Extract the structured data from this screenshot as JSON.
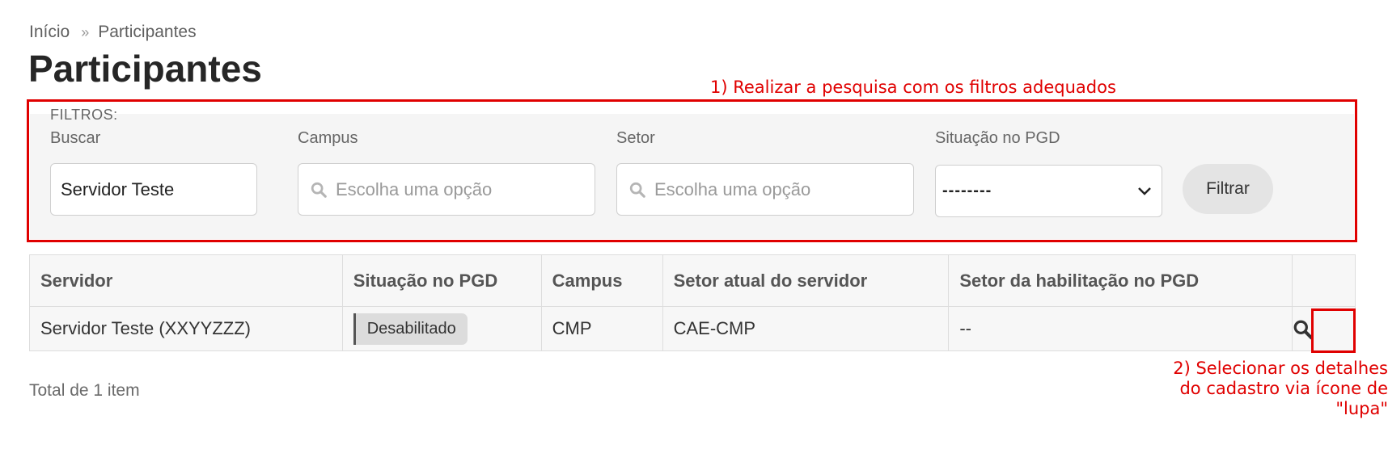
{
  "breadcrumb": {
    "home": "Início",
    "separator": "»",
    "current": "Participantes"
  },
  "page_title": "Participantes",
  "annotations": {
    "step1": "1) Realizar a pesquisa com os filtros adequados",
    "step2_line1": "2) Selecionar os detalhes",
    "step2_line2": "do cadastro via ícone de",
    "step2_line3": "\"lupa\"",
    "color": "#e00000"
  },
  "filters": {
    "legend": "FILTROS:",
    "buscar": {
      "label": "Buscar",
      "value": "Servidor Teste"
    },
    "campus": {
      "label": "Campus",
      "placeholder": "Escolha uma opção",
      "icon": "search-icon"
    },
    "setor": {
      "label": "Setor",
      "placeholder": "Escolha uma opção",
      "icon": "search-icon"
    },
    "situacao": {
      "label": "Situação no PGD",
      "selected": "--------",
      "icon": "chevron-down-icon"
    },
    "submit_label": "Filtrar"
  },
  "table": {
    "headers": [
      "Servidor",
      "Situação no PGD",
      "Campus",
      "Setor atual do servidor",
      "Setor da habilitação no PGD",
      ""
    ],
    "rows": [
      {
        "servidor": "Servidor Teste (XXYYZZZ)",
        "situacao": "Desabilitado",
        "campus": "CMP",
        "setor_atual": "CAE-CMP",
        "setor_habilitacao": "--",
        "action_icon": "magnifier-icon"
      }
    ]
  },
  "total_text": "Total de 1 item"
}
